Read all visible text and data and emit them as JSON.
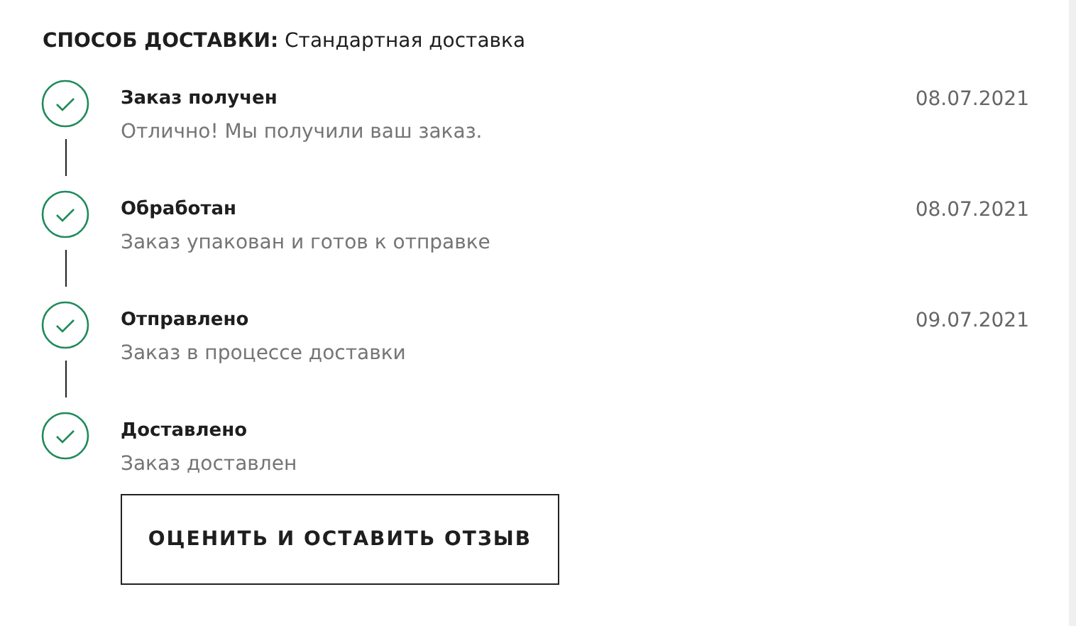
{
  "delivery": {
    "label": "СПОСОБ ДОСТАВКИ:",
    "value": "Стандартная доставка"
  },
  "steps": [
    {
      "title": "Заказ получен",
      "description": "Отлично! Мы получили ваш заказ.",
      "date": "08.07.2021",
      "completed": true
    },
    {
      "title": "Обработан",
      "description": "Заказ упакован и готов к отправке",
      "date": "08.07.2021",
      "completed": true
    },
    {
      "title": "Отправлено",
      "description": "Заказ в процессе доставки",
      "date": "09.07.2021",
      "completed": true
    },
    {
      "title": "Доставлено",
      "description": "Заказ доставлен",
      "completed": true
    }
  ],
  "review_button": "ОЦЕНИТЬ И ОСТАВИТЬ ОТЗЫВ"
}
